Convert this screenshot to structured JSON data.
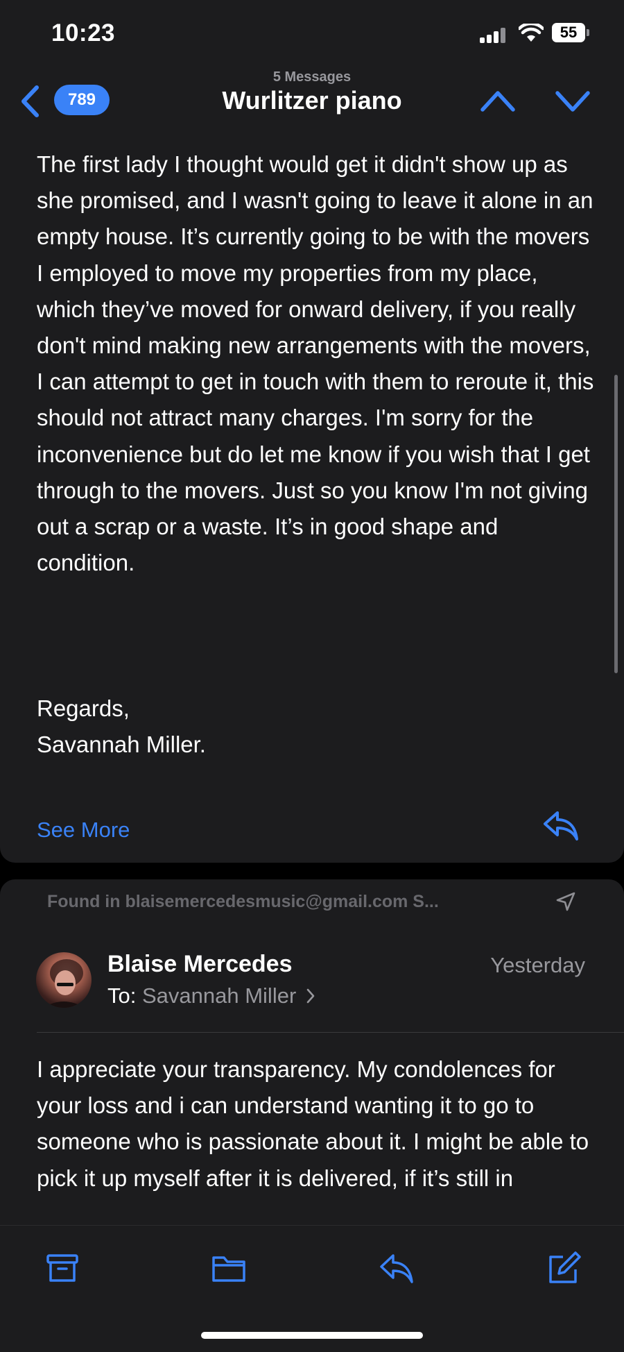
{
  "status_bar": {
    "time": "10:23",
    "battery": "55"
  },
  "nav": {
    "back_count": "789",
    "subtitle": "5 Messages",
    "title": "Wurlitzer piano"
  },
  "message1": {
    "body": "The first lady I thought would get it didn't show up as she promised, and I wasn't going to leave it alone in an empty house. It’s currently going to be with the movers I employed to move my properties from my place, which they’ve moved for onward delivery, if you really don't mind making new arrangements with the movers, I can attempt to get in touch with them to reroute it, this should not attract many charges. I'm sorry for the inconvenience but do let me know if you wish that I get through to the movers. Just so you know I'm not giving out a scrap or a waste. It’s in good shape and condition.",
    "regards": "Regards,",
    "signature": "Savannah Miller.",
    "see_more": "See More"
  },
  "found_in": "Found in blaisemercedesmusic@gmail.com S...",
  "message2": {
    "sender": "Blaise Mercedes",
    "date": "Yesterday",
    "to_label": "To:",
    "to_name": "Savannah Miller",
    "body": "I appreciate your transparency. My condolences for your loss and i can understand wanting it to go to someone who is passionate about it. I might be able to pick it up myself after it is delivered, if it’s still in"
  },
  "colors": {
    "accent": "#3a82f7",
    "background": "#1c1c1e",
    "secondary_text": "#98989d"
  },
  "icons": {
    "toolbar": [
      "archive-icon",
      "folder-icon",
      "reply-icon",
      "compose-icon"
    ]
  }
}
